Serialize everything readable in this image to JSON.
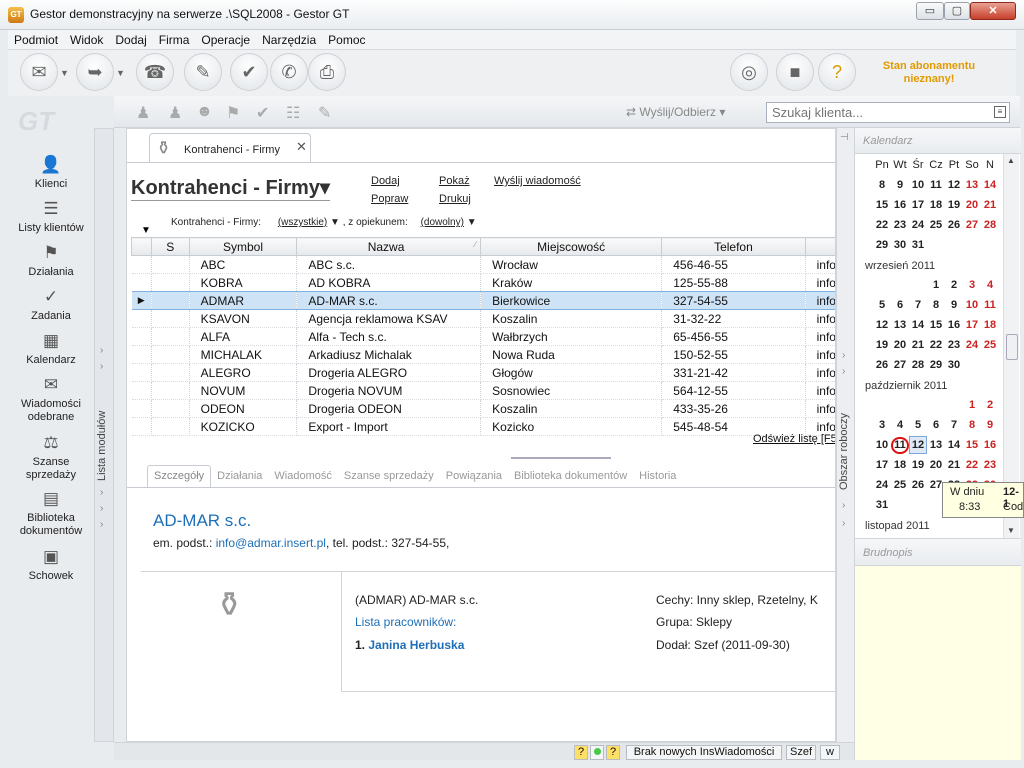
{
  "window": {
    "title": "Gestor demonstracyjny na serwerze .\\SQL2008 - Gestor GT",
    "app_icon_text": "GT",
    "buttons": {
      "minimize": "▭",
      "maximize": "▢",
      "close": "✕"
    }
  },
  "menu": [
    "Podmiot",
    "Widok",
    "Dodaj",
    "Firma",
    "Operacje",
    "Narzędzia",
    "Pomoc"
  ],
  "toolbar": {
    "subscription": "Stan abonamentu nieznany!"
  },
  "logo": "GT",
  "modules": [
    {
      "label": "Klienci",
      "icon": "clients-icon"
    },
    {
      "label": "Listy klientów",
      "icon": "client-lists-icon"
    },
    {
      "label": "Działania",
      "icon": "actions-icon"
    },
    {
      "label": "Zadania",
      "icon": "tasks-icon"
    },
    {
      "label": "Kalendarz",
      "icon": "calendar-icon"
    },
    {
      "label": "Wiadomości odebrane",
      "icon": "inbox-icon"
    },
    {
      "label": "Szanse sprzedaży",
      "icon": "sales-icon"
    },
    {
      "label": "Biblioteka dokumentów",
      "icon": "library-icon"
    },
    {
      "label": "Schowek",
      "icon": "clipboard-icon"
    }
  ],
  "module_strip": "Lista modułów",
  "inner_toolbar": {
    "send_receive": "Wyślij/Odbierz",
    "search_placeholder": "Szukaj klienta..."
  },
  "tab": {
    "label": "Kontrahenci - Firmy",
    "close": "✕"
  },
  "page": {
    "title": "Kontrahenci - Firmy",
    "title_caret": "▾",
    "links": {
      "add": "Dodaj",
      "edit": "Popraw",
      "show": "Pokaż",
      "print": "Drukuj",
      "send": "Wyślij wiadomość"
    },
    "filter": {
      "label": "Kontrahenci - Firmy:",
      "value1": "(wszystkie)",
      "sep": ", z opiekunem:",
      "value2": "(dowolny)"
    },
    "refresh": "Odśwież listę [F5]"
  },
  "grid": {
    "columns": [
      "S",
      "Symbol",
      "Nazwa",
      "Miejscowość",
      "Telefon"
    ],
    "rows": [
      [
        "ABC",
        "ABC s.c.",
        "Wrocław",
        "456-46-55",
        "info"
      ],
      [
        "KOBRA",
        "AD KOBRA",
        "Kraków",
        "125-55-88",
        "info"
      ],
      [
        "ADMAR",
        "AD-MAR s.c.",
        "Bierkowice",
        "327-54-55",
        "info"
      ],
      [
        "KSAVON",
        "Agencja reklamowa KSAV",
        "Koszalin",
        "31-32-22",
        "info"
      ],
      [
        "ALFA",
        "Alfa - Tech s.c.",
        "Wałbrzych",
        "65-456-55",
        "info"
      ],
      [
        "MICHALAK",
        "Arkadiusz Michalak",
        "Nowa Ruda",
        "150-52-55",
        "info"
      ],
      [
        "ALEGRO",
        "Drogeria ALEGRO",
        "Głogów",
        "331-21-42",
        "info"
      ],
      [
        "NOVUM",
        "Drogeria NOVUM",
        "Sosnowiec",
        "564-12-55",
        "info"
      ],
      [
        "ODEON",
        "Drogeria ODEON",
        "Koszalin",
        "433-35-26",
        "info"
      ],
      [
        "KOZICKO",
        "Export - Import",
        "Kozicko",
        "545-48-54",
        "info"
      ]
    ],
    "selected_index": 2
  },
  "detail_tabs": [
    "Szczegóły",
    "Działania",
    "Wiadomość",
    "Szanse sprzedaży",
    "Powiązania",
    "Biblioteka dokumentów",
    "Historia"
  ],
  "detail": {
    "name": "AD-MAR s.c.",
    "contact_prefix": "em. podst.:",
    "email": "info@admar.insert.pl",
    "contact_suffix": ", tel. podst.: 327-54-55,",
    "fullname": "(ADMAR) AD-MAR s.c.",
    "employees_label": "Lista pracowników:",
    "employee_num": "1.",
    "employee": "Janina Herbuska",
    "features": "Cechy: Inny sklep, Rzetelny, K",
    "group": "Grupa: Sklepy",
    "added": "Dodał: Szef (2011-09-30)"
  },
  "work_strip": "Obszar roboczy",
  "calendar": {
    "header": "Kalendarz",
    "weekdays": [
      "Pn",
      "Wt",
      "Śr",
      "Cz",
      "Pt",
      "So",
      "N"
    ],
    "aug_rows": [
      [
        "8",
        "9",
        "10",
        "11",
        "12",
        "13",
        "14"
      ],
      [
        "15",
        "16",
        "17",
        "18",
        "19",
        "20",
        "21"
      ],
      [
        "22",
        "23",
        "24",
        "25",
        "26",
        "27",
        "28"
      ],
      [
        "29",
        "30",
        "31",
        "",
        "",
        "",
        ""
      ]
    ],
    "sep_title": "wrzesień 2011",
    "sep_rows": [
      [
        "",
        "",
        "",
        "1",
        "2",
        "3",
        "4"
      ],
      [
        "5",
        "6",
        "7",
        "8",
        "9",
        "10",
        "11"
      ],
      [
        "12",
        "13",
        "14",
        "15",
        "16",
        "17",
        "18"
      ],
      [
        "19",
        "20",
        "21",
        "22",
        "23",
        "24",
        "25"
      ],
      [
        "26",
        "27",
        "28",
        "29",
        "30",
        "",
        ""
      ]
    ],
    "oct_title": "październik 2011",
    "oct_rows": [
      [
        "",
        "",
        "",
        "",
        "",
        "1",
        "2"
      ],
      [
        "3",
        "4",
        "5",
        "6",
        "7",
        "8",
        "9"
      ],
      [
        "10",
        "11",
        "12",
        "13",
        "14",
        "15",
        "16"
      ],
      [
        "17",
        "18",
        "19",
        "20",
        "21",
        "22",
        "23"
      ],
      [
        "24",
        "25",
        "26",
        "27",
        "28",
        "29",
        "30"
      ],
      [
        "31",
        "",
        "",
        "",
        "",
        "",
        ""
      ]
    ],
    "nov_title": "listopad 2011",
    "tooltip": {
      "line1": "W dniu",
      "line2": "8:33",
      "col2a": "12-1",
      "col2b": "Cod"
    }
  },
  "scratch": {
    "header": "Brudnopis"
  },
  "status": {
    "message": "Brak nowych InsWiadomości",
    "user": "Szef",
    "q": "?",
    "w": "w"
  }
}
